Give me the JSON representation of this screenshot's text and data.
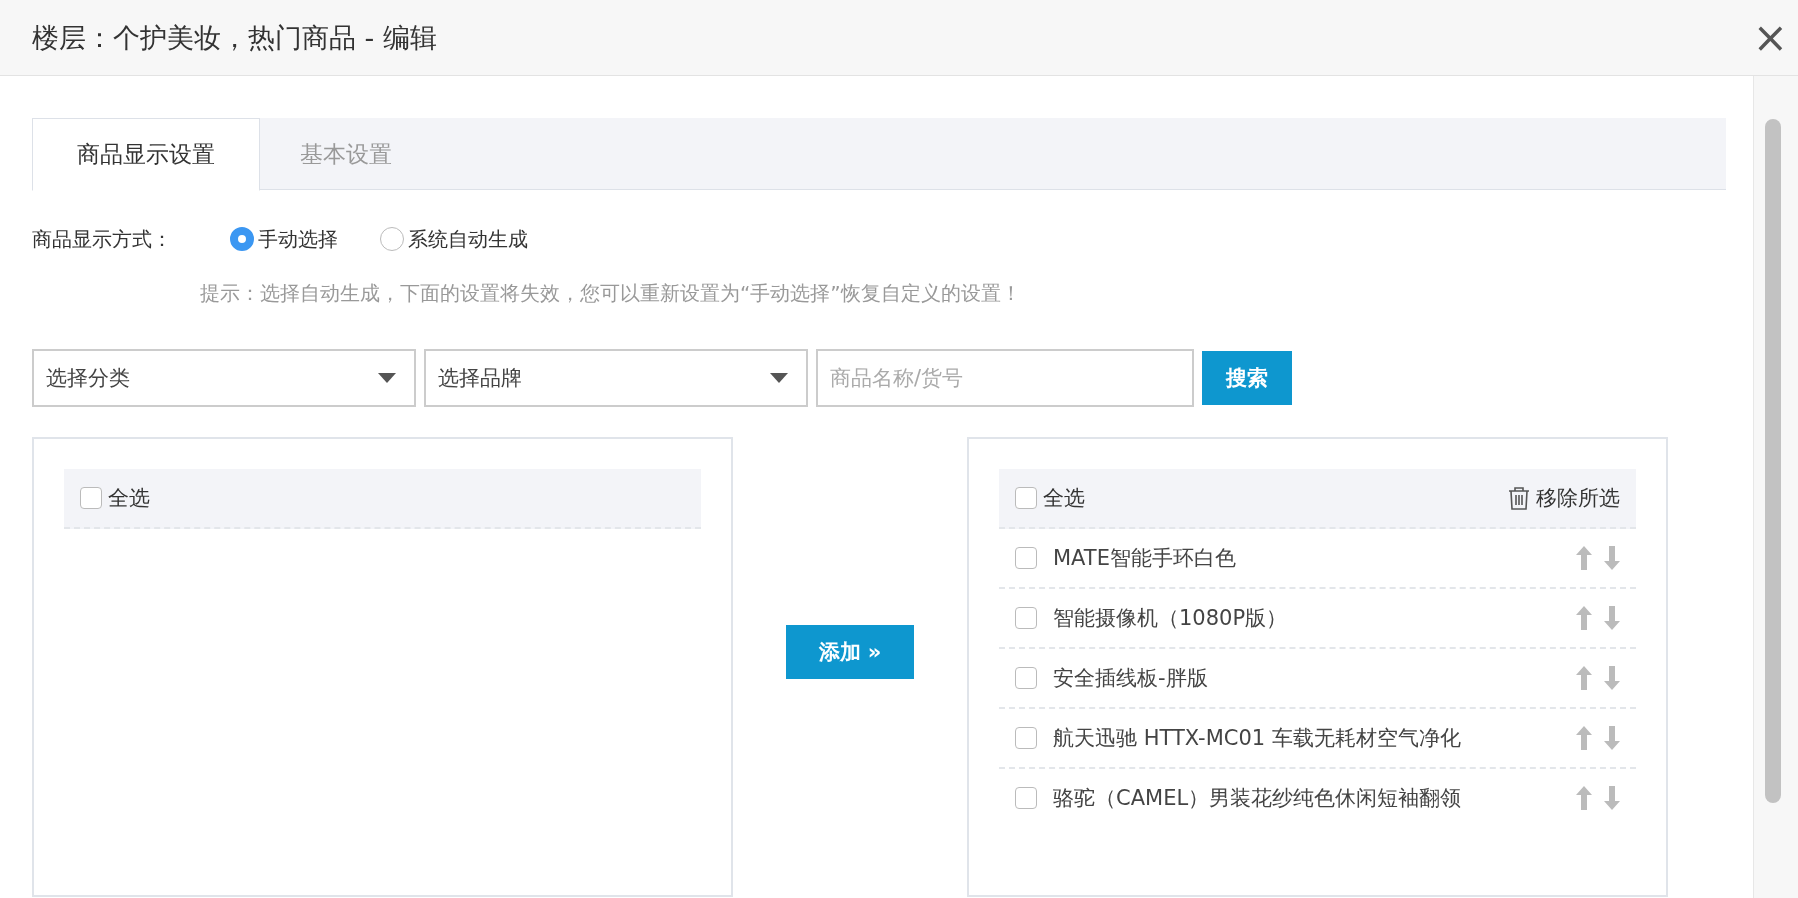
{
  "dialog": {
    "title": "楼层：个护美妆，热门商品 - 编辑",
    "close": "×"
  },
  "tabs": [
    {
      "label": "商品显示设置",
      "selected": true
    },
    {
      "label": "基本设置",
      "selected": false
    }
  ],
  "display_mode": {
    "label": "商品显示方式：",
    "options": [
      {
        "label": "手动选择",
        "selected": true
      },
      {
        "label": "系统自动生成",
        "selected": false
      }
    ],
    "hint": "提示：选择自动生成，下面的设置将失效，您可以重新设置为“手动选择”恢复自定义的设置！"
  },
  "filters": {
    "category": "选择分类",
    "brand": "选择品牌",
    "search": {
      "placeholder": "商品名称/货号"
    },
    "search_button": "搜索"
  },
  "left_panel": {
    "select_all": {
      "label": "全选",
      "checked": false
    }
  },
  "add_button": "添加 »",
  "right_panel": {
    "select_all": {
      "label": "全选",
      "checked": false
    },
    "remove_selected": "移除所选",
    "items": [
      {
        "name": "MATE智能手环白色",
        "checked": false
      },
      {
        "name": "智能摄像机（1080P版）",
        "checked": false
      },
      {
        "name": "安全插线板-胖版",
        "checked": false
      },
      {
        "name": "航天迅驰 HTTX-MC01 车载无耗材空气净化",
        "checked": false
      },
      {
        "name": "骆驼（CAMEL）男装花纱纯色休闲短袖翻领",
        "checked": false
      }
    ]
  }
}
